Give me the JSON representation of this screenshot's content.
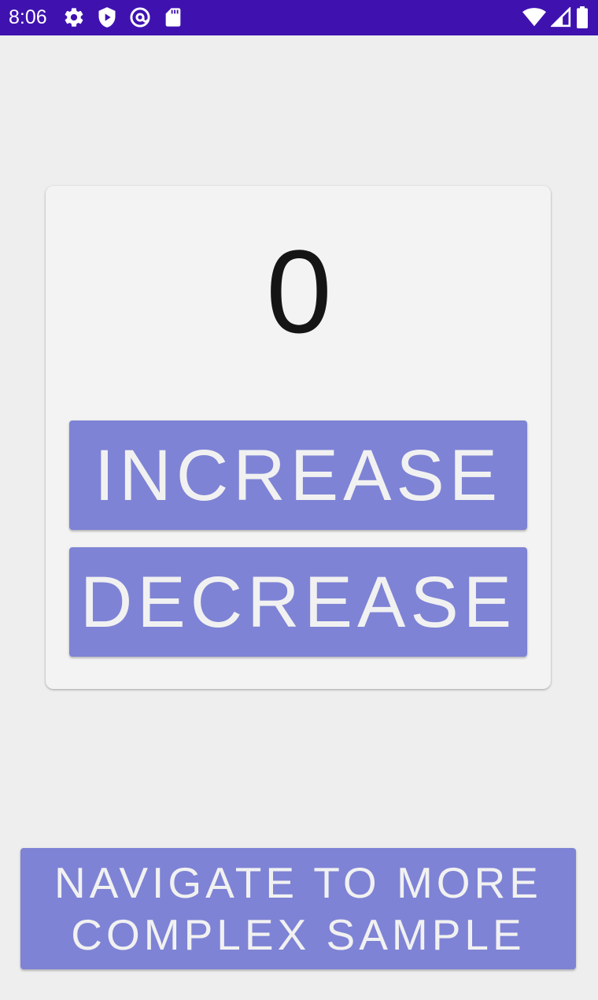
{
  "status_bar": {
    "time": "8:06",
    "background": "#3f12b0",
    "left_icons": [
      "gear-icon",
      "shield-play-icon",
      "at-sign-icon",
      "sd-card-icon"
    ],
    "right_icons": [
      "wifi-icon",
      "cell-signal-icon",
      "battery-icon"
    ]
  },
  "counter": {
    "value": "0"
  },
  "buttons": {
    "increase_label": "INCREASE",
    "decrease_label": "DECREASE",
    "navigate_label": "NAVIGATE TO MORE COMPLEX SAMPLE"
  },
  "colors": {
    "button": "#7e83d5",
    "button_text": "#f1f1f1",
    "card": "#f3f3f3",
    "background": "#eeeeee"
  }
}
